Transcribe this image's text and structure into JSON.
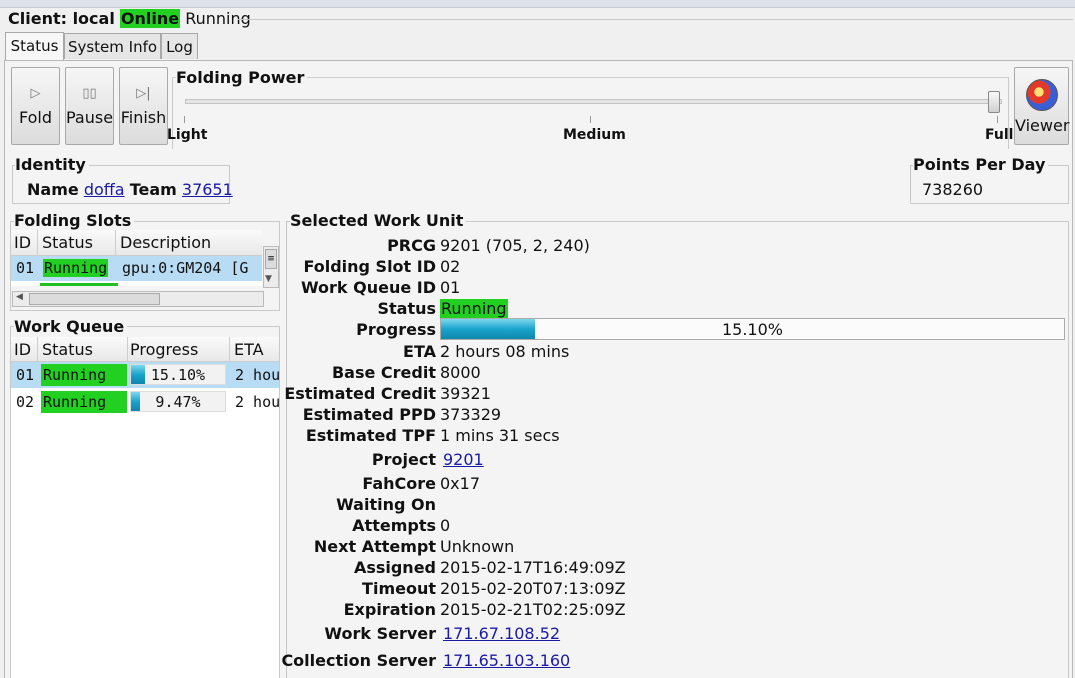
{
  "client": {
    "label": "Client: local",
    "online": "Online",
    "state": "Running"
  },
  "tabs": [
    "Status",
    "System Info",
    "Log"
  ],
  "buttons": {
    "fold": "Fold",
    "pause": "Pause",
    "finish": "Finish",
    "viewer": "Viewer"
  },
  "folding_power": {
    "title": "Folding Power",
    "light": "Light",
    "medium": "Medium",
    "full": "Full",
    "level": 1.0
  },
  "identity": {
    "title": "Identity",
    "name_label": "Name",
    "name": "doffa",
    "team_label": "Team",
    "team": "37651"
  },
  "ppd": {
    "title": "Points Per Day",
    "value": "738260"
  },
  "slots": {
    "title": "Folding Slots",
    "headers": [
      "ID",
      "Status",
      "Description"
    ],
    "rows": [
      {
        "id": "01",
        "status": "Running",
        "description": "gpu:0:GM204 [G"
      }
    ]
  },
  "queue": {
    "title": "Work Queue",
    "headers": [
      "ID",
      "Status",
      "Progress",
      "ETA"
    ],
    "rows": [
      {
        "id": "01",
        "status": "Running",
        "progress": "15.10%",
        "progress_value": 0.151,
        "eta": "2 hou"
      },
      {
        "id": "02",
        "status": "Running",
        "progress": "9.47%",
        "progress_value": 0.0947,
        "eta": "2 hou"
      }
    ]
  },
  "wu": {
    "title": "Selected Work Unit",
    "labels": {
      "prcg": "PRCG",
      "slot": "Folding Slot ID",
      "queue": "Work Queue ID",
      "status": "Status",
      "progress": "Progress",
      "eta": "ETA",
      "base_credit": "Base Credit",
      "est_credit": "Estimated Credit",
      "est_ppd": "Estimated PPD",
      "est_tpf": "Estimated TPF",
      "project": "Project",
      "fahcore": "FahCore",
      "waiting": "Waiting On",
      "attempts": "Attempts",
      "next_attempt": "Next Attempt",
      "assigned": "Assigned",
      "timeout": "Timeout",
      "expiration": "Expiration",
      "work_server": "Work Server",
      "collection_server": "Collection Server"
    },
    "values": {
      "prcg": "9201 (705, 2, 240)",
      "slot": "02",
      "queue": "01",
      "status": "Running",
      "progress": "15.10%",
      "progress_value": 0.151,
      "eta": "2 hours 08 mins",
      "base_credit": "8000",
      "est_credit": "39321",
      "est_ppd": "373329",
      "est_tpf": "1 mins 31 secs",
      "project": "9201",
      "fahcore": "0x17",
      "waiting": "",
      "attempts": "0",
      "next_attempt": "Unknown",
      "assigned": "2015-02-17T16:49:09Z",
      "timeout": "2015-02-20T07:13:09Z",
      "expiration": "2015-02-21T02:25:09Z",
      "work_server": "171.67.108.52",
      "collection_server": "171.65.103.160"
    }
  },
  "colors": {
    "running": "#22d022",
    "selected_row": "#b8dcf4",
    "progress_fill": "#1aa4cc",
    "link": "#1a1aa6"
  }
}
